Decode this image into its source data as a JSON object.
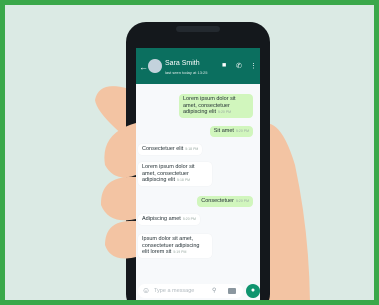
{
  "contact": {
    "name": "Sara Smith",
    "status": "last seen today at 13:25"
  },
  "icons": {
    "back": "arrow-left-icon",
    "video": "video-camera-icon",
    "call": "phone-icon",
    "menu": "more-vert-icon",
    "emoji": "emoji-icon",
    "attach": "paperclip-icon",
    "camera": "camera-icon",
    "mic": "microphone-icon"
  },
  "messages": [
    {
      "direction": "out",
      "text": "Lorem ipsum dolor sit amet, consectetuer adipiscing elit",
      "time": "5:20 PM"
    },
    {
      "direction": "out",
      "text": "Sit amet",
      "time": "5:20 PM"
    },
    {
      "direction": "in",
      "text": "Consectetuer elit",
      "time": "5:18 PM"
    },
    {
      "direction": "in",
      "text": "Lorem ipsum dolor sit amet, consectetuer adipiscing elit",
      "time": "5:18 PM"
    },
    {
      "direction": "out",
      "text": "Consectetuer",
      "time": "5:20 PM"
    },
    {
      "direction": "in",
      "text": "Adipiscing amet",
      "time": "5:20 PM"
    },
    {
      "direction": "in",
      "text": "Ipsum dolor sit amet, consectetuer adipiscing elit lorem sit",
      "time": "5:19 PM"
    }
  ],
  "composer": {
    "placeholder": "Type a message"
  },
  "colors": {
    "frame": "#3aa84a",
    "background": "#dbeae4",
    "appbar": "#0b6f5f",
    "outgoing_bubble": "#d1f6bd",
    "incoming_bubble": "#ffffff",
    "mic_button": "#10956f",
    "phone": "#14181c",
    "skin": "#f3c4a3"
  }
}
